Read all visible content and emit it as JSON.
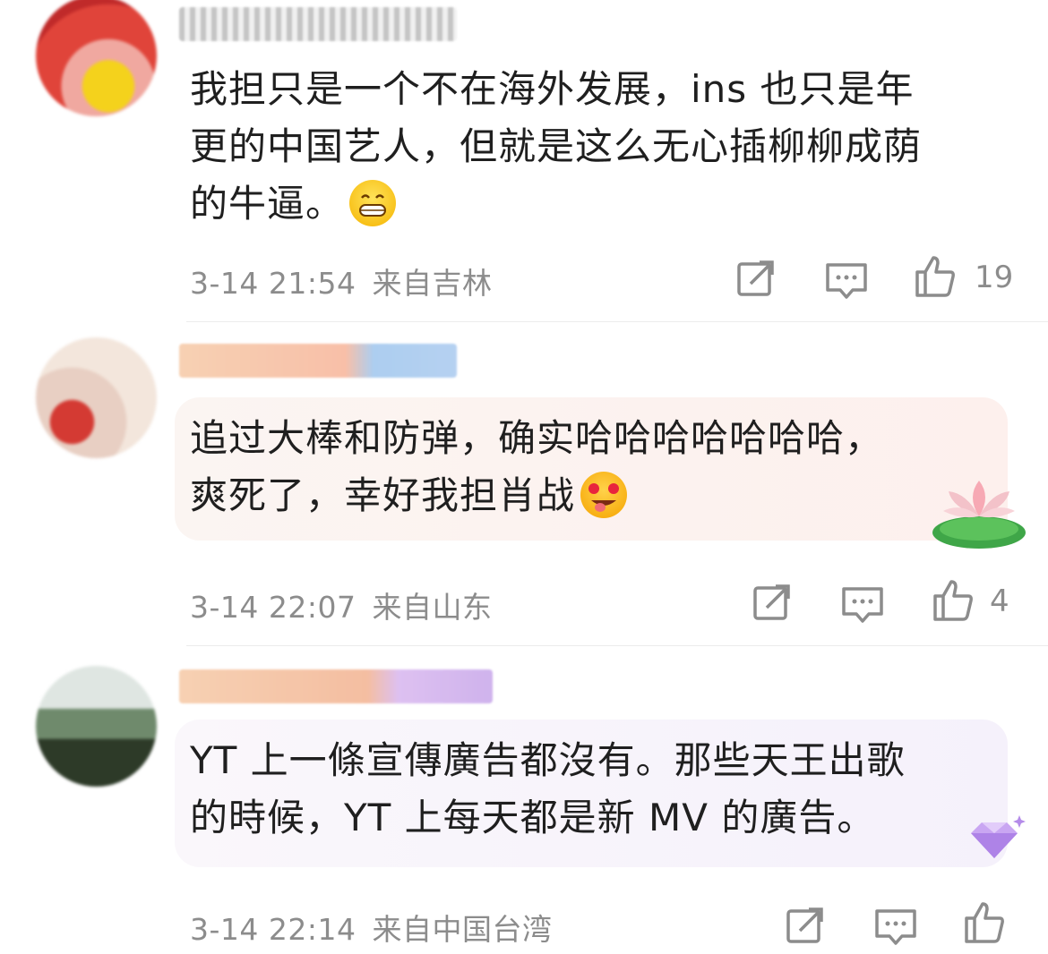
{
  "comments": [
    {
      "text_line1": "我担只是一个不在海外发展，ins 也只是年",
      "text_line2": "更的中国艺人，但就是这么无心插柳柳成荫",
      "text_line3": "的牛逼。",
      "emoji": "grinning-face-emoji",
      "time": "3-14 21:54",
      "location": "来自吉林",
      "likes": "19"
    },
    {
      "text_line1": "追过大棒和防弹，确实哈哈哈哈哈哈哈，",
      "text_line2": "爽死了，幸好我担肖战",
      "emoji": "heart-eyes-tongue-emoji",
      "time": "3-14 22:07",
      "location": "来自山东",
      "likes": "4"
    },
    {
      "text_line1": "YT 上一條宣傳廣告都沒有。那些天王出歌",
      "text_line2": "的時候，YT 上每天都是新 MV 的廣告。",
      "time": "3-14 22:14",
      "location": "来自中国台湾"
    }
  ],
  "icons": {
    "share": "share-icon",
    "comment": "comment-icon",
    "like": "thumbs-up-icon",
    "decor": "lotus-sticker"
  },
  "colors": {
    "meta_text": "#8c8c8c",
    "bubble2": "#fdf3f1",
    "bubble3": "#f6f3fb",
    "divider": "#ececec"
  }
}
